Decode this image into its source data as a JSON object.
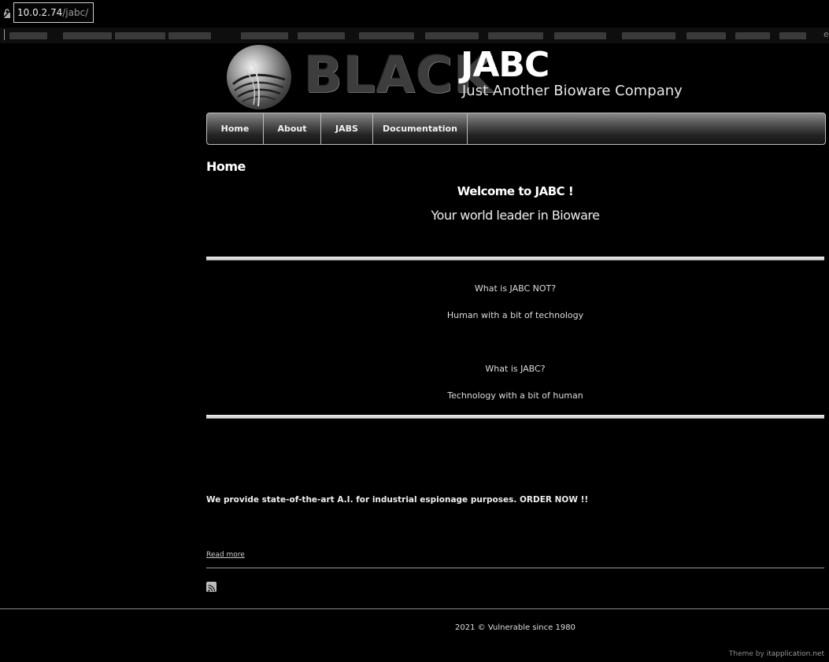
{
  "browser": {
    "url_host": "10.0.2.74",
    "url_path": "/jabc/",
    "lock_icon": "lock-icon",
    "bookmarks_edge_glyph": "e"
  },
  "header": {
    "logo_word": "BLACK",
    "site_title": "JABC",
    "tagline": "Just Another Bioware Company"
  },
  "nav": {
    "items": [
      {
        "label": "Home"
      },
      {
        "label": "About"
      },
      {
        "label": "JABS"
      },
      {
        "label": "Documentation"
      }
    ]
  },
  "content": {
    "page_title": "Home",
    "welcome": "Welcome to JABC !",
    "subtitle": "Your world leader in Bioware",
    "q1": "What is JABC NOT?",
    "a1": "Human with a bit of technology",
    "q2": "What is JABC?",
    "a2": "Technology with a bit of human",
    "promo": "We provide state-of-the-art A.I. for industrial espionage purposes. ORDER  NOW !!",
    "read_more": "Read more",
    "rss_icon": "rss-icon"
  },
  "footer": {
    "copyright": "2021 © Vulnerable since 1980",
    "theme_prefix": "Theme by ",
    "theme_link": "itapplication.net"
  }
}
